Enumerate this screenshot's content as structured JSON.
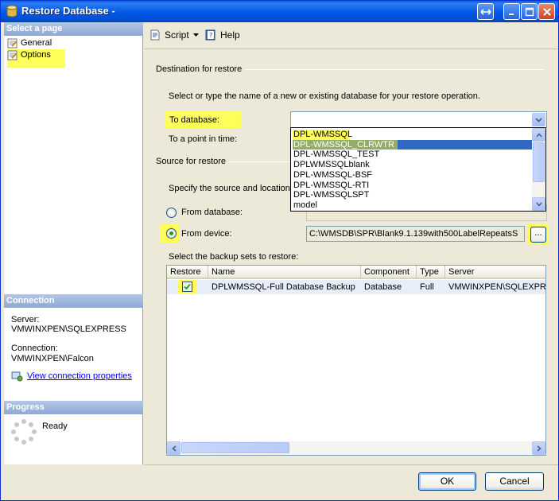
{
  "window": {
    "title": "Restore Database -"
  },
  "left": {
    "select_page": "Select a page",
    "pages": [
      "General",
      "Options"
    ],
    "connection_header": "Connection",
    "server_label": "Server:",
    "server_value": "VMWINXPEN\\SQLEXPRESS",
    "connection_label": "Connection:",
    "connection_value": "VMWINXPEN\\Falcon",
    "view_link": "View connection properties",
    "progress_header": "Progress",
    "progress_status": "Ready"
  },
  "toolbar": {
    "script": "Script",
    "help": "Help"
  },
  "destination": {
    "group": "Destination for restore",
    "instruction": "Select or type the name of a new or existing database for your restore operation.",
    "to_database_label": "To database:",
    "to_database_value": "",
    "point_in_time_label": "To a point in time:"
  },
  "dropdown": {
    "items": [
      "DPL-WMSSQL",
      "DPL-WMSSQL_CLRWTR",
      "DPL-WMSSQL_TEST",
      "DPLWMSSQLblank",
      "DPL-WMSSQL-BSF",
      "DPL-WMSSQL-RTI",
      "DPL-WMSSQLSPT",
      "model"
    ],
    "selected_index": 1
  },
  "source": {
    "group": "Source for restore",
    "instruction": "Specify the source and location",
    "from_database_label": "From database:",
    "from_device_label": "From device:",
    "device_path": "C:\\WMSDB\\SPR\\Blank9.1.139with500LabelRepeatsS",
    "browse_label": "...",
    "selected_option": "from_device"
  },
  "backupsets": {
    "label": "Select the backup sets to restore:",
    "columns": [
      "Restore",
      "Name",
      "Component",
      "Type",
      "Server"
    ],
    "rows": [
      {
        "restore": true,
        "name": "DPLWMSSQL-Full Database Backup",
        "component": "Database",
        "type": "Full",
        "server": "VMWINXPEN\\SQLEXPRESS"
      }
    ]
  },
  "footer": {
    "ok": "OK",
    "cancel": "Cancel"
  },
  "colors": {
    "titlebar": "#0058e6",
    "highlight": "#ffff5c",
    "selection": "#316ac5"
  }
}
